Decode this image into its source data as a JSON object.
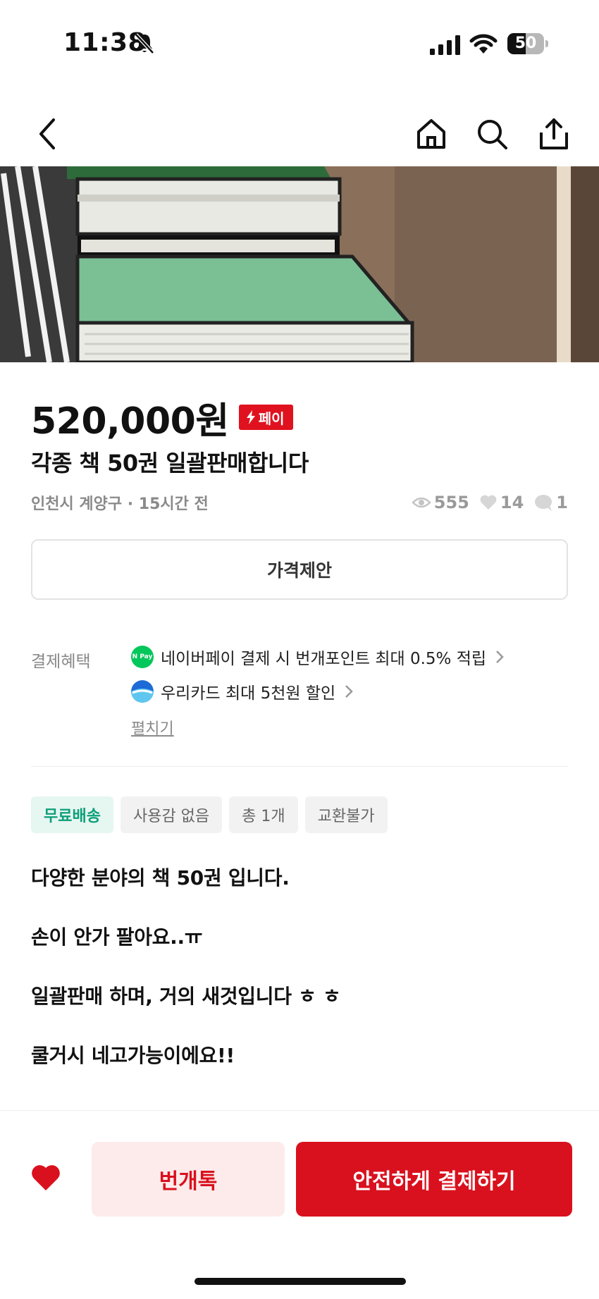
{
  "status_bar": {
    "time": "11:38",
    "battery": "50",
    "battery_level": 0.5
  },
  "nav": {
    "back_icon": "chevron-left-icon",
    "home_icon": "home-icon",
    "search_icon": "search-icon",
    "share_icon": "share-icon"
  },
  "product": {
    "price": "520,000원",
    "pay_badge": "페이",
    "title": "각종 책 50권 일괄판매합니다",
    "location_time": "인천시 계양구 · 15시간 전",
    "views": "555",
    "likes": "14",
    "chats": "1"
  },
  "offer_button": "가격제안",
  "benefits": {
    "label": "결제혜택",
    "items": [
      {
        "text": "네이버페이 결제 시 번개포인트 최대 0.5% 적립",
        "icon": "naver-pay-logo",
        "logo_text": "N Pay"
      },
      {
        "text": "우리카드 최대 5천원 할인",
        "icon": "woori-card-logo"
      }
    ],
    "expand": "펼치기"
  },
  "tags": [
    "무료배송",
    "사용감 없음",
    "총 1개",
    "교환불가"
  ],
  "description": [
    "다양한 분야의 책 50권 입니다.",
    "손이 안가 팔아요..ㅠ",
    "일괄판매 하며, 거의 새것입니다 ㅎ ㅎ",
    "쿨거시 네고가능이에요!!"
  ],
  "bottom": {
    "chat_button": "번개톡",
    "pay_button": "안전하게 결제하기"
  },
  "colors": {
    "brand_red": "#d9111e",
    "tag_green": "#0e9f7a"
  }
}
